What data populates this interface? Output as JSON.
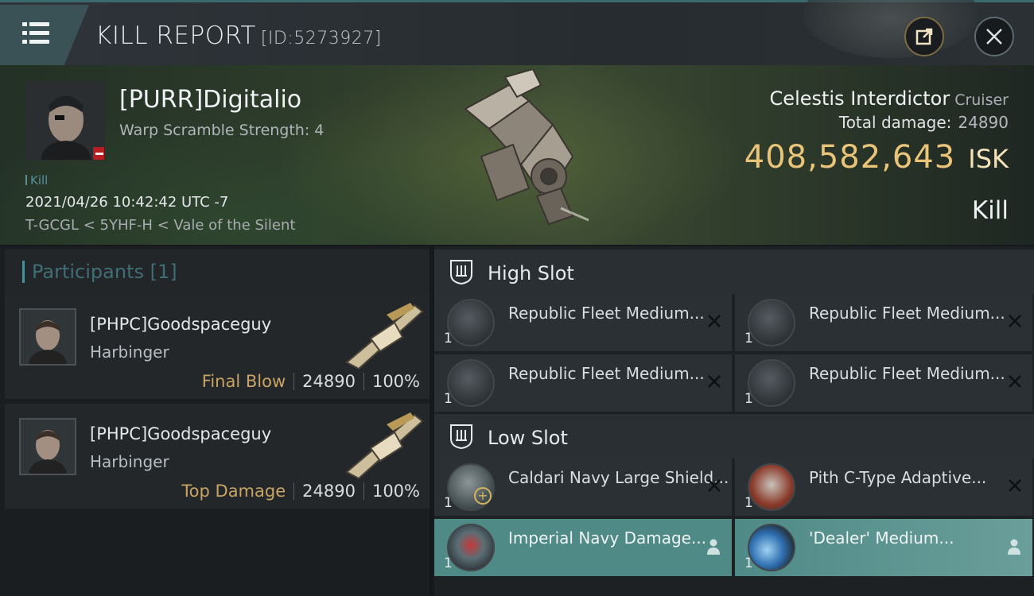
{
  "header": {
    "title": "KILL REPORT",
    "report_id": "[ID:5273927]"
  },
  "victim": {
    "name": "[PURR]Digitalio",
    "warp_scramble": "Warp Scramble Strength: 4",
    "kill_tag": "Kill",
    "date": "2021/04/26 10:42:42 UTC -7",
    "location": "T-GCGL < 5YHF-H < Vale of the Silent"
  },
  "ship": {
    "name": "Celestis Interdictor",
    "class": "Cruiser",
    "total_damage_label": "Total damage:",
    "total_damage": "24890",
    "isk_value": "408,582,643",
    "isk_unit": "ISK",
    "result": "Kill"
  },
  "participants": {
    "label": "Participants",
    "count": "[1]",
    "items": [
      {
        "name": "[PHPC]Goodspaceguy",
        "ship": "Harbinger",
        "role": "Final Blow",
        "damage": "24890",
        "percent": "100%"
      },
      {
        "name": "[PHPC]Goodspaceguy",
        "ship": "Harbinger",
        "role": "Top Damage",
        "damage": "24890",
        "percent": "100%"
      }
    ]
  },
  "slots": {
    "high": {
      "label": "High Slot",
      "items": [
        {
          "name": "Republic Fleet Medium...",
          "qty": "1",
          "status": "destroyed"
        },
        {
          "name": "Republic Fleet Medium...",
          "qty": "1",
          "status": "destroyed"
        },
        {
          "name": "Republic Fleet Medium...",
          "qty": "1",
          "status": "destroyed"
        },
        {
          "name": "Republic Fleet Medium...",
          "qty": "1",
          "status": "destroyed"
        }
      ]
    },
    "low": {
      "label": "Low Slot",
      "items": [
        {
          "name": "Caldari Navy Large Shield...",
          "qty": "1",
          "status": "destroyed"
        },
        {
          "name": "Pith C-Type Adaptive...",
          "qty": "1",
          "status": "destroyed"
        },
        {
          "name": "Imperial Navy Damage...",
          "qty": "1",
          "status": "dropped"
        },
        {
          "name": "'Dealer' Medium...",
          "qty": "1",
          "status": "dropped"
        }
      ]
    }
  },
  "colors": {
    "accent_teal": "#4f8a87",
    "isk_gold": "#e9c479",
    "final_blow_gold": "#c9a463"
  }
}
